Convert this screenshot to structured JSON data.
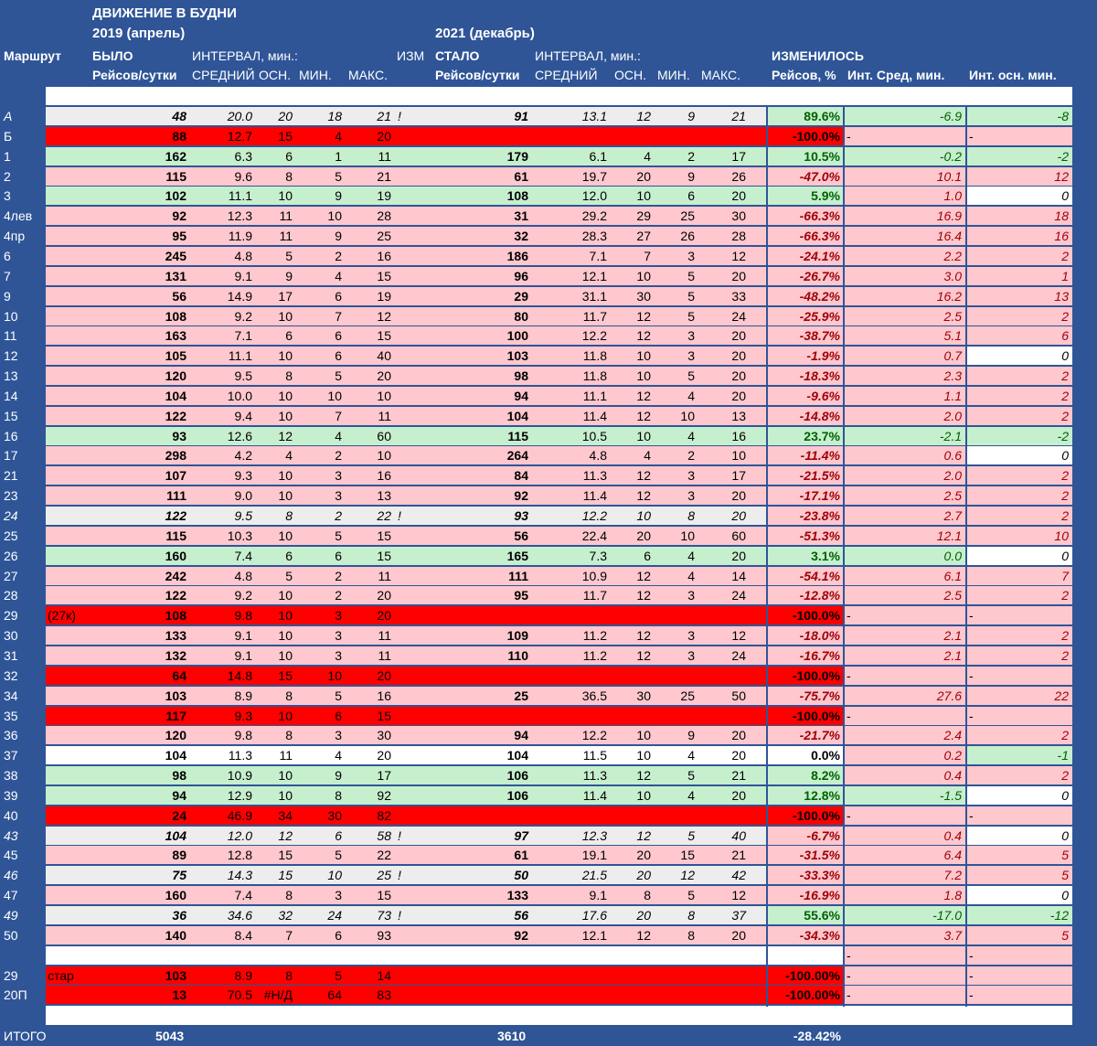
{
  "header": {
    "title": "ДВИЖЕНИЕ В БУДНИ",
    "period_before": "2019 (апрель)",
    "period_after": "2021 (декабрь)",
    "route_col": "Маршрут",
    "before_label": "БЫЛО",
    "interval_label_before": "ИНТЕРВАЛ, мин.:",
    "izm_label": "ИЗМ",
    "after_label": "СТАЛО",
    "interval_label_after": "ИНТЕРВАЛ, мин.:",
    "changed_label": "ИЗМЕНИЛОСЬ",
    "trips_per_day": "Рейсов/сутки",
    "avg": "СРЕДНИЙ",
    "main": "ОСН.",
    "min": "МИН.",
    "max": "МАКС.",
    "trips_pct": "Рейсов, %",
    "int_avg_change": "Инт. Сред, мин.",
    "int_main_change": "Инт. осн. мин."
  },
  "colors": {
    "header_blue": "#2f5597",
    "light_red": "#ffc7ce",
    "light_green": "#c6efce",
    "strong_red": "#ff0000",
    "gray": "#ededed",
    "white": "#ffffff",
    "dark_red_text": "#9c0006",
    "dark_green_text": "#006100"
  },
  "rows": [
    {
      "route": "А",
      "note": "",
      "t1": "48",
      "a1": "20.0",
      "m1": "20",
      "n1": "18",
      "x1": "21",
      "izm": "!",
      "t2": "91",
      "a2": "13.1",
      "m2": "12",
      "n2": "9",
      "x2": "21",
      "pct": "89.6%",
      "da": "-6.9",
      "dm": "-8",
      "style": "gray",
      "pct_bg": "green",
      "da_bg": "green",
      "dm_bg": "green"
    },
    {
      "route": "Б",
      "note": "",
      "t1": "88",
      "a1": "12.7",
      "m1": "15",
      "n1": "4",
      "x1": "20",
      "izm": "",
      "t2": "",
      "a2": "",
      "m2": "",
      "n2": "",
      "x2": "",
      "pct": "-100.0%",
      "da": "-",
      "dm": "-",
      "style": "red",
      "pct_bg": "red",
      "da_bg": "pink",
      "dm_bg": "pink"
    },
    {
      "route": "1",
      "note": "",
      "t1": "162",
      "a1": "6.3",
      "m1": "6",
      "n1": "1",
      "x1": "11",
      "izm": "",
      "t2": "179",
      "a2": "6.1",
      "m2": "4",
      "n2": "2",
      "x2": "17",
      "pct": "10.5%",
      "da": "-0.2",
      "dm": "-2",
      "style": "green",
      "pct_bg": "green",
      "da_bg": "green",
      "dm_bg": "green"
    },
    {
      "route": "2",
      "note": "",
      "t1": "115",
      "a1": "9.6",
      "m1": "8",
      "n1": "5",
      "x1": "21",
      "izm": "",
      "t2": "61",
      "a2": "19.7",
      "m2": "20",
      "n2": "9",
      "x2": "26",
      "pct": "-47.0%",
      "da": "10.1",
      "dm": "12",
      "style": "pink",
      "pct_bg": "pink",
      "da_bg": "pink",
      "dm_bg": "pink"
    },
    {
      "route": "3",
      "note": "",
      "t1": "102",
      "a1": "11.1",
      "m1": "10",
      "n1": "9",
      "x1": "19",
      "izm": "",
      "t2": "108",
      "a2": "12.0",
      "m2": "10",
      "n2": "6",
      "x2": "20",
      "pct": "5.9%",
      "da": "1.0",
      "dm": "0",
      "style": "green",
      "pct_bg": "green",
      "da_bg": "pink",
      "dm_bg": "white"
    },
    {
      "route": "4лев",
      "note": "",
      "t1": "92",
      "a1": "12.3",
      "m1": "11",
      "n1": "10",
      "x1": "28",
      "izm": "",
      "t2": "31",
      "a2": "29.2",
      "m2": "29",
      "n2": "25",
      "x2": "30",
      "pct": "-66.3%",
      "da": "16.9",
      "dm": "18",
      "style": "pink",
      "pct_bg": "pink",
      "da_bg": "pink",
      "dm_bg": "pink"
    },
    {
      "route": "4пр",
      "note": "",
      "t1": "95",
      "a1": "11.9",
      "m1": "11",
      "n1": "9",
      "x1": "25",
      "izm": "",
      "t2": "32",
      "a2": "28.3",
      "m2": "27",
      "n2": "26",
      "x2": "28",
      "pct": "-66.3%",
      "da": "16.4",
      "dm": "16",
      "style": "pink",
      "pct_bg": "pink",
      "da_bg": "pink",
      "dm_bg": "pink"
    },
    {
      "route": "6",
      "note": "",
      "t1": "245",
      "a1": "4.8",
      "m1": "5",
      "n1": "2",
      "x1": "16",
      "izm": "",
      "t2": "186",
      "a2": "7.1",
      "m2": "7",
      "n2": "3",
      "x2": "12",
      "pct": "-24.1%",
      "da": "2.2",
      "dm": "2",
      "style": "pink",
      "pct_bg": "pink",
      "da_bg": "pink",
      "dm_bg": "pink"
    },
    {
      "route": "7",
      "note": "",
      "t1": "131",
      "a1": "9.1",
      "m1": "9",
      "n1": "4",
      "x1": "15",
      "izm": "",
      "t2": "96",
      "a2": "12.1",
      "m2": "10",
      "n2": "5",
      "x2": "20",
      "pct": "-26.7%",
      "da": "3.0",
      "dm": "1",
      "style": "pink",
      "pct_bg": "pink",
      "da_bg": "pink",
      "dm_bg": "pink"
    },
    {
      "route": "9",
      "note": "",
      "t1": "56",
      "a1": "14.9",
      "m1": "17",
      "n1": "6",
      "x1": "19",
      "izm": "",
      "t2": "29",
      "a2": "31.1",
      "m2": "30",
      "n2": "5",
      "x2": "33",
      "pct": "-48.2%",
      "da": "16.2",
      "dm": "13",
      "style": "pink",
      "pct_bg": "pink",
      "da_bg": "pink",
      "dm_bg": "pink"
    },
    {
      "route": "10",
      "note": "",
      "t1": "108",
      "a1": "9.2",
      "m1": "10",
      "n1": "7",
      "x1": "12",
      "izm": "",
      "t2": "80",
      "a2": "11.7",
      "m2": "12",
      "n2": "5",
      "x2": "24",
      "pct": "-25.9%",
      "da": "2.5",
      "dm": "2",
      "style": "pink",
      "pct_bg": "pink",
      "da_bg": "pink",
      "dm_bg": "pink"
    },
    {
      "route": "11",
      "note": "",
      "t1": "163",
      "a1": "7.1",
      "m1": "6",
      "n1": "6",
      "x1": "15",
      "izm": "",
      "t2": "100",
      "a2": "12.2",
      "m2": "12",
      "n2": "3",
      "x2": "20",
      "pct": "-38.7%",
      "da": "5.1",
      "dm": "6",
      "style": "pink",
      "pct_bg": "pink",
      "da_bg": "pink",
      "dm_bg": "pink"
    },
    {
      "route": "12",
      "note": "",
      "t1": "105",
      "a1": "11.1",
      "m1": "10",
      "n1": "6",
      "x1": "40",
      "izm": "",
      "t2": "103",
      "a2": "11.8",
      "m2": "10",
      "n2": "3",
      "x2": "20",
      "pct": "-1.9%",
      "da": "0.7",
      "dm": "0",
      "style": "pink",
      "pct_bg": "pink",
      "da_bg": "pink",
      "dm_bg": "white"
    },
    {
      "route": "13",
      "note": "",
      "t1": "120",
      "a1": "9.5",
      "m1": "8",
      "n1": "5",
      "x1": "20",
      "izm": "",
      "t2": "98",
      "a2": "11.8",
      "m2": "10",
      "n2": "5",
      "x2": "20",
      "pct": "-18.3%",
      "da": "2.3",
      "dm": "2",
      "style": "pink",
      "pct_bg": "pink",
      "da_bg": "pink",
      "dm_bg": "pink"
    },
    {
      "route": "14",
      "note": "",
      "t1": "104",
      "a1": "10.0",
      "m1": "10",
      "n1": "10",
      "x1": "10",
      "izm": "",
      "t2": "94",
      "a2": "11.1",
      "m2": "12",
      "n2": "4",
      "x2": "20",
      "pct": "-9.6%",
      "da": "1.1",
      "dm": "2",
      "style": "pink",
      "pct_bg": "pink",
      "da_bg": "pink",
      "dm_bg": "pink"
    },
    {
      "route": "15",
      "note": "",
      "t1": "122",
      "a1": "9.4",
      "m1": "10",
      "n1": "7",
      "x1": "11",
      "izm": "",
      "t2": "104",
      "a2": "11.4",
      "m2": "12",
      "n2": "10",
      "x2": "13",
      "pct": "-14.8%",
      "da": "2.0",
      "dm": "2",
      "style": "pink",
      "pct_bg": "pink",
      "da_bg": "pink",
      "dm_bg": "pink"
    },
    {
      "route": "16",
      "note": "",
      "t1": "93",
      "a1": "12.6",
      "m1": "12",
      "n1": "4",
      "x1": "60",
      "izm": "",
      "t2": "115",
      "a2": "10.5",
      "m2": "10",
      "n2": "4",
      "x2": "16",
      "pct": "23.7%",
      "da": "-2.1",
      "dm": "-2",
      "style": "green",
      "pct_bg": "green",
      "da_bg": "green",
      "dm_bg": "green"
    },
    {
      "route": "17",
      "note": "",
      "t1": "298",
      "a1": "4.2",
      "m1": "4",
      "n1": "2",
      "x1": "10",
      "izm": "",
      "t2": "264",
      "a2": "4.8",
      "m2": "4",
      "n2": "2",
      "x2": "10",
      "pct": "-11.4%",
      "da": "0.6",
      "dm": "0",
      "style": "pink",
      "pct_bg": "pink",
      "da_bg": "pink",
      "dm_bg": "white"
    },
    {
      "route": "21",
      "note": "",
      "t1": "107",
      "a1": "9.3",
      "m1": "10",
      "n1": "3",
      "x1": "16",
      "izm": "",
      "t2": "84",
      "a2": "11.3",
      "m2": "12",
      "n2": "3",
      "x2": "17",
      "pct": "-21.5%",
      "da": "2.0",
      "dm": "2",
      "style": "pink",
      "pct_bg": "pink",
      "da_bg": "pink",
      "dm_bg": "pink"
    },
    {
      "route": "23",
      "note": "",
      "t1": "111",
      "a1": "9.0",
      "m1": "10",
      "n1": "3",
      "x1": "13",
      "izm": "",
      "t2": "92",
      "a2": "11.4",
      "m2": "12",
      "n2": "3",
      "x2": "20",
      "pct": "-17.1%",
      "da": "2.5",
      "dm": "2",
      "style": "pink",
      "pct_bg": "pink",
      "da_bg": "pink",
      "dm_bg": "pink"
    },
    {
      "route": "24",
      "note": "",
      "t1": "122",
      "a1": "9.5",
      "m1": "8",
      "n1": "2",
      "x1": "22",
      "izm": "!",
      "t2": "93",
      "a2": "12.2",
      "m2": "10",
      "n2": "8",
      "x2": "20",
      "pct": "-23.8%",
      "da": "2.7",
      "dm": "2",
      "style": "gray",
      "pct_bg": "pink",
      "da_bg": "pink",
      "dm_bg": "pink"
    },
    {
      "route": "25",
      "note": "",
      "t1": "115",
      "a1": "10.3",
      "m1": "10",
      "n1": "5",
      "x1": "15",
      "izm": "",
      "t2": "56",
      "a2": "22.4",
      "m2": "20",
      "n2": "10",
      "x2": "60",
      "pct": "-51.3%",
      "da": "12.1",
      "dm": "10",
      "style": "pink",
      "pct_bg": "pink",
      "da_bg": "pink",
      "dm_bg": "pink"
    },
    {
      "route": "26",
      "note": "",
      "t1": "160",
      "a1": "7.4",
      "m1": "6",
      "n1": "6",
      "x1": "15",
      "izm": "",
      "t2": "165",
      "a2": "7.3",
      "m2": "6",
      "n2": "4",
      "x2": "20",
      "pct": "3.1%",
      "da": "0.0",
      "dm": "0",
      "style": "green",
      "pct_bg": "green",
      "da_bg": "green",
      "dm_bg": "white"
    },
    {
      "route": "27",
      "note": "",
      "t1": "242",
      "a1": "4.8",
      "m1": "5",
      "n1": "2",
      "x1": "11",
      "izm": "",
      "t2": "111",
      "a2": "10.9",
      "m2": "12",
      "n2": "4",
      "x2": "14",
      "pct": "-54.1%",
      "da": "6.1",
      "dm": "7",
      "style": "pink",
      "pct_bg": "pink",
      "da_bg": "pink",
      "dm_bg": "pink"
    },
    {
      "route": "28",
      "note": "",
      "t1": "122",
      "a1": "9.2",
      "m1": "10",
      "n1": "2",
      "x1": "20",
      "izm": "",
      "t2": "95",
      "a2": "11.7",
      "m2": "12",
      "n2": "3",
      "x2": "24",
      "pct": "-12.8%",
      "da": "2.5",
      "dm": "2",
      "style": "pink",
      "pct_bg": "pink",
      "da_bg": "pink",
      "dm_bg": "pink"
    },
    {
      "route": "29",
      "note": "(27к)",
      "t1": "108",
      "a1": "9.8",
      "m1": "10",
      "n1": "3",
      "x1": "20",
      "izm": "",
      "t2": "",
      "a2": "",
      "m2": "",
      "n2": "",
      "x2": "",
      "pct": "-100.0%",
      "da": "-",
      "dm": "-",
      "style": "red",
      "pct_bg": "red",
      "da_bg": "pink",
      "dm_bg": "pink"
    },
    {
      "route": "30",
      "note": "",
      "t1": "133",
      "a1": "9.1",
      "m1": "10",
      "n1": "3",
      "x1": "11",
      "izm": "",
      "t2": "109",
      "a2": "11.2",
      "m2": "12",
      "n2": "3",
      "x2": "12",
      "pct": "-18.0%",
      "da": "2.1",
      "dm": "2",
      "style": "pink",
      "pct_bg": "pink",
      "da_bg": "pink",
      "dm_bg": "pink"
    },
    {
      "route": "31",
      "note": "",
      "t1": "132",
      "a1": "9.1",
      "m1": "10",
      "n1": "3",
      "x1": "11",
      "izm": "",
      "t2": "110",
      "a2": "11.2",
      "m2": "12",
      "n2": "3",
      "x2": "24",
      "pct": "-16.7%",
      "da": "2.1",
      "dm": "2",
      "style": "pink",
      "pct_bg": "pink",
      "da_bg": "pink",
      "dm_bg": "pink"
    },
    {
      "route": "32",
      "note": "",
      "t1": "64",
      "a1": "14.8",
      "m1": "15",
      "n1": "10",
      "x1": "20",
      "izm": "",
      "t2": "",
      "a2": "",
      "m2": "",
      "n2": "",
      "x2": "",
      "pct": "-100.0%",
      "da": "-",
      "dm": "-",
      "style": "red",
      "pct_bg": "red",
      "da_bg": "pink",
      "dm_bg": "pink"
    },
    {
      "route": "34",
      "note": "",
      "t1": "103",
      "a1": "8.9",
      "m1": "8",
      "n1": "5",
      "x1": "16",
      "izm": "",
      "t2": "25",
      "a2": "36.5",
      "m2": "30",
      "n2": "25",
      "x2": "50",
      "pct": "-75.7%",
      "da": "27.6",
      "dm": "22",
      "style": "pink",
      "pct_bg": "pink",
      "da_bg": "pink",
      "dm_bg": "pink"
    },
    {
      "route": "35",
      "note": "",
      "t1": "117",
      "a1": "9.3",
      "m1": "10",
      "n1": "6",
      "x1": "15",
      "izm": "",
      "t2": "",
      "a2": "",
      "m2": "",
      "n2": "",
      "x2": "",
      "pct": "-100.0%",
      "da": "-",
      "dm": "-",
      "style": "red",
      "pct_bg": "red",
      "da_bg": "pink",
      "dm_bg": "pink"
    },
    {
      "route": "36",
      "note": "",
      "t1": "120",
      "a1": "9.8",
      "m1": "8",
      "n1": "3",
      "x1": "30",
      "izm": "",
      "t2": "94",
      "a2": "12.2",
      "m2": "10",
      "n2": "9",
      "x2": "20",
      "pct": "-21.7%",
      "da": "2.4",
      "dm": "2",
      "style": "pink",
      "pct_bg": "pink",
      "da_bg": "pink",
      "dm_bg": "pink"
    },
    {
      "route": "37",
      "note": "",
      "t1": "104",
      "a1": "11.3",
      "m1": "11",
      "n1": "4",
      "x1": "20",
      "izm": "",
      "t2": "104",
      "a2": "11.5",
      "m2": "10",
      "n2": "4",
      "x2": "20",
      "pct": "0.0%",
      "da": "0.2",
      "dm": "-1",
      "style": "white",
      "pct_bg": "white",
      "da_bg": "pink",
      "dm_bg": "green"
    },
    {
      "route": "38",
      "note": "",
      "t1": "98",
      "a1": "10.9",
      "m1": "10",
      "n1": "9",
      "x1": "17",
      "izm": "",
      "t2": "106",
      "a2": "11.3",
      "m2": "12",
      "n2": "5",
      "x2": "21",
      "pct": "8.2%",
      "da": "0.4",
      "dm": "2",
      "style": "green",
      "pct_bg": "green",
      "da_bg": "pink",
      "dm_bg": "pink"
    },
    {
      "route": "39",
      "note": "",
      "t1": "94",
      "a1": "12.9",
      "m1": "10",
      "n1": "8",
      "x1": "92",
      "izm": "",
      "t2": "106",
      "a2": "11.4",
      "m2": "10",
      "n2": "4",
      "x2": "20",
      "pct": "12.8%",
      "da": "-1.5",
      "dm": "0",
      "style": "green",
      "pct_bg": "green",
      "da_bg": "green",
      "dm_bg": "white"
    },
    {
      "route": "40",
      "note": "",
      "t1": "24",
      "a1": "46.9",
      "m1": "34",
      "n1": "30",
      "x1": "82",
      "izm": "",
      "t2": "",
      "a2": "",
      "m2": "",
      "n2": "",
      "x2": "",
      "pct": "-100.0%",
      "da": "-",
      "dm": "-",
      "style": "red",
      "pct_bg": "red",
      "da_bg": "pink",
      "dm_bg": "pink"
    },
    {
      "route": "43",
      "note": "",
      "t1": "104",
      "a1": "12.0",
      "m1": "12",
      "n1": "6",
      "x1": "58",
      "izm": "!",
      "t2": "97",
      "a2": "12.3",
      "m2": "12",
      "n2": "5",
      "x2": "40",
      "pct": "-6.7%",
      "da": "0.4",
      "dm": "0",
      "style": "gray",
      "pct_bg": "pink",
      "da_bg": "pink",
      "dm_bg": "white"
    },
    {
      "route": "45",
      "note": "",
      "t1": "89",
      "a1": "12.8",
      "m1": "15",
      "n1": "5",
      "x1": "22",
      "izm": "",
      "t2": "61",
      "a2": "19.1",
      "m2": "20",
      "n2": "15",
      "x2": "21",
      "pct": "-31.5%",
      "da": "6.4",
      "dm": "5",
      "style": "pink",
      "pct_bg": "pink",
      "da_bg": "pink",
      "dm_bg": "pink"
    },
    {
      "route": "46",
      "note": "",
      "t1": "75",
      "a1": "14.3",
      "m1": "15",
      "n1": "10",
      "x1": "25",
      "izm": "!",
      "t2": "50",
      "a2": "21.5",
      "m2": "20",
      "n2": "12",
      "x2": "42",
      "pct": "-33.3%",
      "da": "7.2",
      "dm": "5",
      "style": "gray",
      "pct_bg": "pink",
      "da_bg": "pink",
      "dm_bg": "pink"
    },
    {
      "route": "47",
      "note": "",
      "t1": "160",
      "a1": "7.4",
      "m1": "8",
      "n1": "3",
      "x1": "15",
      "izm": "",
      "t2": "133",
      "a2": "9.1",
      "m2": "8",
      "n2": "5",
      "x2": "12",
      "pct": "-16.9%",
      "da": "1.8",
      "dm": "0",
      "style": "pink",
      "pct_bg": "pink",
      "da_bg": "pink",
      "dm_bg": "white"
    },
    {
      "route": "49",
      "note": "",
      "t1": "36",
      "a1": "34.6",
      "m1": "32",
      "n1": "24",
      "x1": "73",
      "izm": "!",
      "t2": "56",
      "a2": "17.6",
      "m2": "20",
      "n2": "8",
      "x2": "37",
      "pct": "55.6%",
      "da": "-17.0",
      "dm": "-12",
      "style": "gray",
      "pct_bg": "green",
      "da_bg": "green",
      "dm_bg": "green"
    },
    {
      "route": "50",
      "note": "",
      "t1": "140",
      "a1": "8.4",
      "m1": "7",
      "n1": "6",
      "x1": "93",
      "izm": "",
      "t2": "92",
      "a2": "12.1",
      "m2": "12",
      "n2": "8",
      "x2": "20",
      "pct": "-34.3%",
      "da": "3.7",
      "dm": "5",
      "style": "pink",
      "pct_bg": "pink",
      "da_bg": "pink",
      "dm_bg": "pink"
    },
    {
      "route": "",
      "note": "",
      "t1": "",
      "a1": "",
      "m1": "",
      "n1": "",
      "x1": "",
      "izm": "",
      "t2": "",
      "a2": "",
      "m2": "",
      "n2": "",
      "x2": "",
      "pct": "",
      "da": "-",
      "dm": "-",
      "style": "white",
      "pct_bg": "white",
      "da_bg": "pink",
      "dm_bg": "pink"
    },
    {
      "route": "29",
      "note": "стар",
      "t1": "103",
      "a1": "8.9",
      "m1": "8",
      "n1": "5",
      "x1": "14",
      "izm": "",
      "t2": "",
      "a2": "",
      "m2": "",
      "n2": "",
      "x2": "",
      "pct": "-100.00%",
      "da": "-",
      "dm": "-",
      "style": "red",
      "pct_bg": "red",
      "da_bg": "pink",
      "dm_bg": "pink"
    },
    {
      "route": "20П",
      "note": "",
      "t1": "13",
      "a1": "70.5",
      "m1": "#Н/Д",
      "n1": "64",
      "x1": "83",
      "izm": "",
      "t2": "",
      "a2": "",
      "m2": "",
      "n2": "",
      "x2": "",
      "pct": "-100.00%",
      "da": "-",
      "dm": "-",
      "style": "red",
      "pct_bg": "red",
      "da_bg": "pink",
      "dm_bg": "pink"
    },
    {
      "route": "",
      "note": "",
      "t1": "",
      "a1": "",
      "m1": "",
      "n1": "",
      "x1": "",
      "izm": "",
      "t2": "",
      "a2": "",
      "m2": "",
      "n2": "",
      "x2": "",
      "pct": "",
      "da": "",
      "dm": "",
      "style": "white",
      "pct_bg": "white",
      "da_bg": "white",
      "dm_bg": "white"
    }
  ],
  "totals": {
    "label": "ИТОГО",
    "before": "5043",
    "after": "3610",
    "pct": "-28.42%"
  }
}
